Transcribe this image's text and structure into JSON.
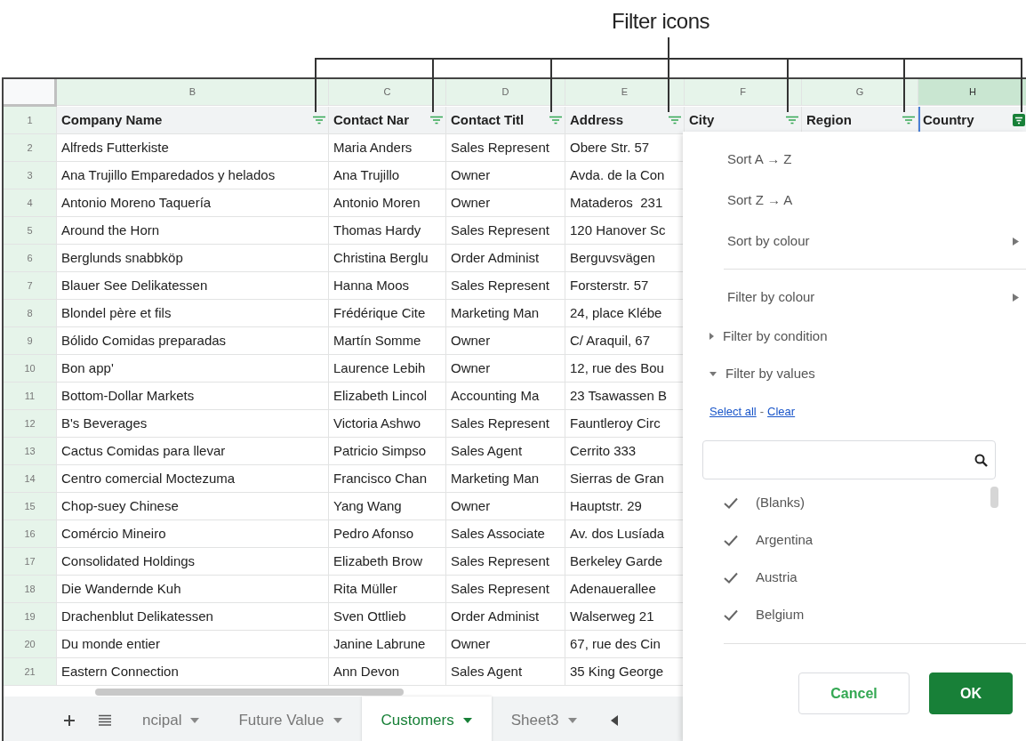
{
  "annotation": {
    "label": "Filter icons"
  },
  "sheet": {
    "column_letters": [
      {
        "label": "B",
        "selected": false
      },
      {
        "label": "C",
        "selected": false
      },
      {
        "label": "D",
        "selected": false
      },
      {
        "label": "E",
        "selected": false
      },
      {
        "label": "F",
        "selected": false
      },
      {
        "label": "G",
        "selected": false
      },
      {
        "label": "H",
        "selected": true
      }
    ],
    "header_row": {
      "number": "1",
      "cells": [
        {
          "text": "Company Name",
          "selected": false,
          "filter_active": false
        },
        {
          "text": "Contact Nar",
          "selected": false,
          "filter_active": false
        },
        {
          "text": "Contact Titl",
          "selected": false,
          "filter_active": false
        },
        {
          "text": "Address",
          "selected": false,
          "filter_active": false
        },
        {
          "text": "City",
          "selected": false,
          "filter_active": false
        },
        {
          "text": "Region",
          "selected": false,
          "filter_active": false
        },
        {
          "text": "Country",
          "selected": true,
          "filter_active": true
        }
      ]
    },
    "rows": [
      {
        "number": "2",
        "cells": [
          "Alfreds Futterkiste",
          "Maria Anders",
          "Sales Represent",
          "Obere Str. 57"
        ]
      },
      {
        "number": "3",
        "cells": [
          "Ana Trujillo Emparedados y helados",
          "Ana Trujillo",
          "Owner",
          "Avda. de la Con"
        ]
      },
      {
        "number": "4",
        "cells": [
          "Antonio Moreno Taquería",
          "Antonio Moren",
          "Owner",
          "Mataderos  231"
        ]
      },
      {
        "number": "5",
        "cells": [
          "Around the Horn",
          "Thomas Hardy",
          "Sales Represent",
          "120 Hanover Sc"
        ]
      },
      {
        "number": "6",
        "cells": [
          "Berglunds snabbköp",
          "Christina Berglu",
          "Order Administ",
          "Berguvsvägen"
        ]
      },
      {
        "number": "7",
        "cells": [
          "Blauer See Delikatessen",
          "Hanna Moos",
          "Sales Represent",
          "Forsterstr. 57"
        ]
      },
      {
        "number": "8",
        "cells": [
          "Blondel père et fils",
          "Frédérique Cite",
          "Marketing Man",
          "24, place Klébe"
        ]
      },
      {
        "number": "9",
        "cells": [
          "Bólido Comidas preparadas",
          "Martín Somme",
          "Owner",
          "C/ Araquil, 67"
        ]
      },
      {
        "number": "10",
        "cells": [
          "Bon app'",
          "Laurence Lebih",
          "Owner",
          "12, rue des Bou"
        ]
      },
      {
        "number": "11",
        "cells": [
          "Bottom-Dollar Markets",
          "Elizabeth Lincol",
          "Accounting Ma",
          "23 Tsawassen B"
        ]
      },
      {
        "number": "12",
        "cells": [
          "B's Beverages",
          "Victoria Ashwo",
          "Sales Represent",
          "Fauntleroy Circ"
        ]
      },
      {
        "number": "13",
        "cells": [
          "Cactus Comidas para llevar",
          "Patricio Simpso",
          "Sales Agent",
          "Cerrito 333"
        ]
      },
      {
        "number": "14",
        "cells": [
          "Centro comercial Moctezuma",
          "Francisco Chan",
          "Marketing Man",
          "Sierras de Gran"
        ]
      },
      {
        "number": "15",
        "cells": [
          "Chop-suey Chinese",
          "Yang Wang",
          "Owner",
          "Hauptstr. 29"
        ]
      },
      {
        "number": "16",
        "cells": [
          "Comércio Mineiro",
          "Pedro Afonso",
          "Sales Associate",
          "Av. dos Lusíada"
        ]
      },
      {
        "number": "17",
        "cells": [
          "Consolidated Holdings",
          "Elizabeth Brow",
          "Sales Represent",
          "Berkeley Garde"
        ]
      },
      {
        "number": "18",
        "cells": [
          "Die Wandernde Kuh",
          "Rita Müller",
          "Sales Represent",
          "Adenauerallee"
        ]
      },
      {
        "number": "19",
        "cells": [
          "Drachenblut Delikatessen",
          "Sven Ottlieb",
          "Order Administ",
          "Walserweg 21"
        ]
      },
      {
        "number": "20",
        "cells": [
          "Du monde entier",
          "Janine Labrune",
          "Owner",
          "67, rue des Cin"
        ]
      },
      {
        "number": "21",
        "cells": [
          "Eastern Connection",
          "Ann Devon",
          "Sales Agent",
          "35 King George"
        ]
      }
    ]
  },
  "sheet_tabs": [
    {
      "label": "ncipal",
      "selected": false
    },
    {
      "label": "Future Value",
      "selected": false
    },
    {
      "label": "Customers",
      "selected": true
    },
    {
      "label": "Sheet3",
      "selected": false
    }
  ],
  "filter_menu": {
    "sort_items": [
      {
        "label": "Sort A → Z",
        "kind": "action"
      },
      {
        "label": "Sort Z → A",
        "kind": "action"
      },
      {
        "label": "Sort by colour",
        "kind": "submenu"
      }
    ],
    "filter_items": [
      {
        "label": "Filter by colour",
        "kind": "submenu"
      },
      {
        "label": "Filter by condition",
        "kind": "section",
        "expanded": false
      },
      {
        "label": "Filter by values",
        "kind": "section",
        "expanded": true
      }
    ],
    "links": [
      "Select all",
      "Clear"
    ],
    "link_separator": "-",
    "values": [
      {
        "label": "(Blanks)",
        "checked": true
      },
      {
        "label": "Argentina",
        "checked": true
      },
      {
        "label": "Austria",
        "checked": true
      },
      {
        "label": "Belgium",
        "checked": true
      }
    ],
    "buttons": [
      {
        "label": "Cancel",
        "kind": "secondary"
      },
      {
        "label": "OK",
        "kind": "primary"
      }
    ]
  }
}
